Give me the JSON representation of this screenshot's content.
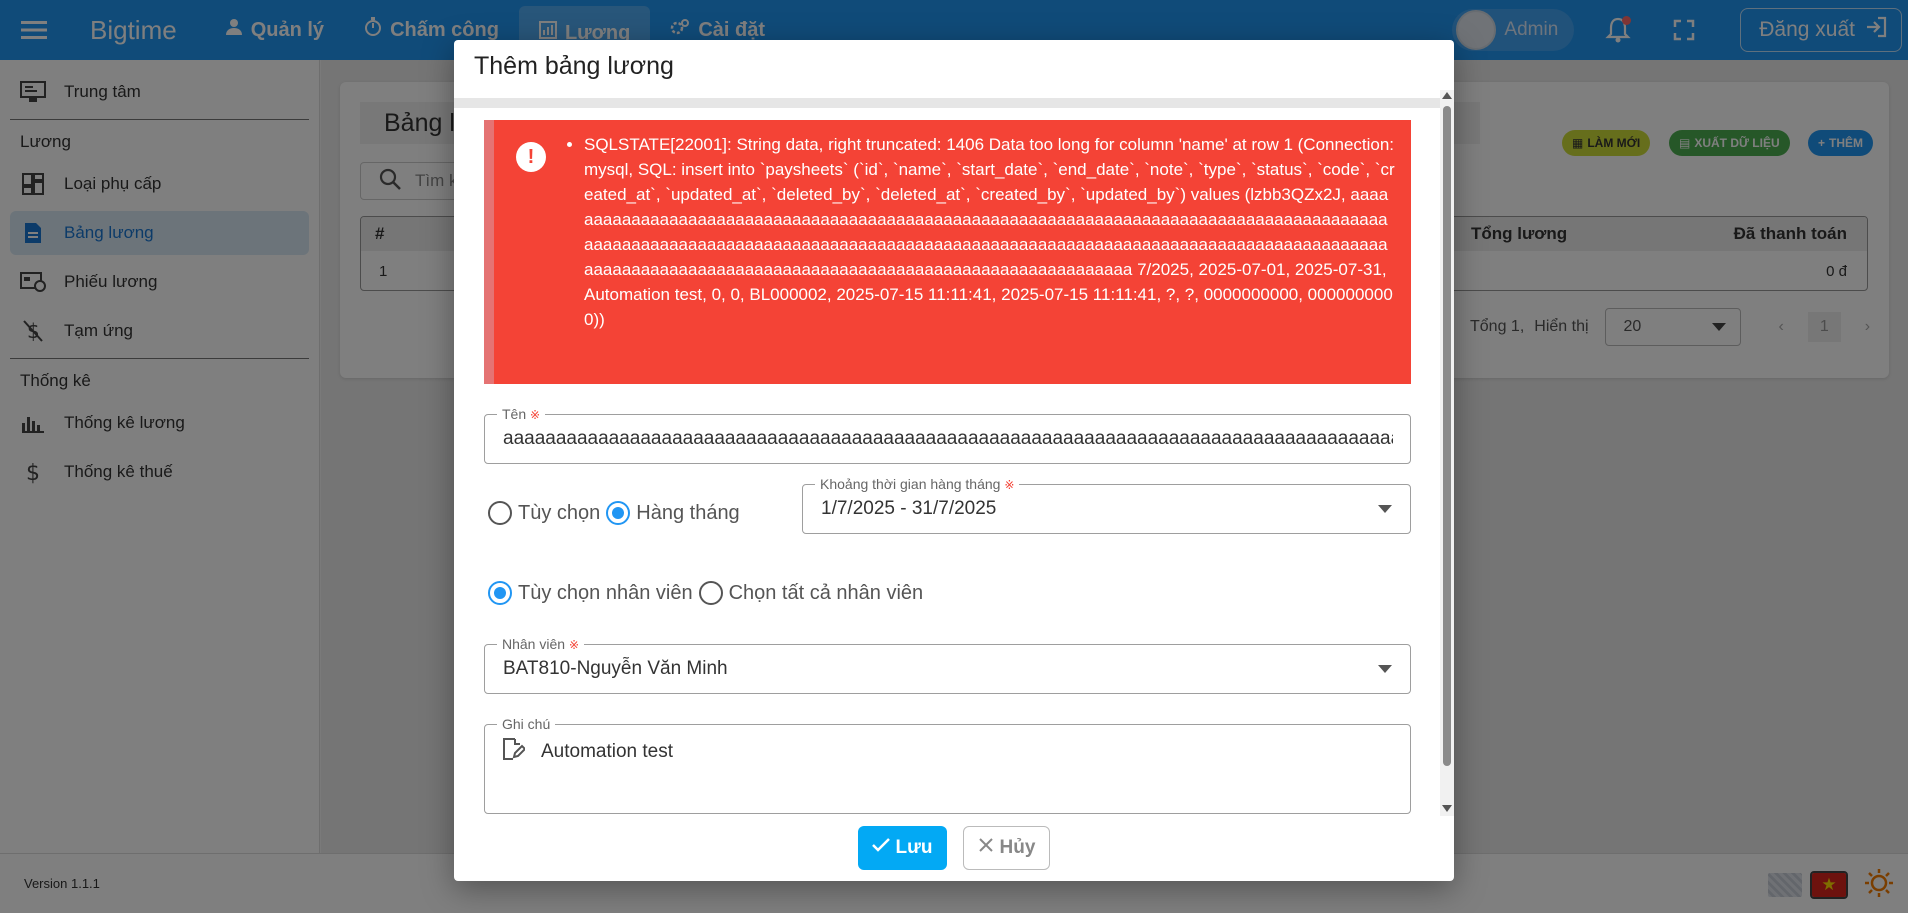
{
  "app": {
    "brand": "Bigtime",
    "nav": [
      {
        "label": "Quản lý"
      },
      {
        "label": "Chấm công"
      },
      {
        "label": "Lương"
      },
      {
        "label": "Cài đặt"
      }
    ],
    "user_name": "Admin",
    "logout_label": "Đăng xuất"
  },
  "sidebar": {
    "top_item": "Trung tâm",
    "section_luong": "Lương",
    "luong_items": [
      {
        "label": "Loại phụ cấp"
      },
      {
        "label": "Bảng lương"
      },
      {
        "label": "Phiếu lương"
      },
      {
        "label": "Tạm ứng"
      }
    ],
    "section_thongke": "Thống kê",
    "thongke_items": [
      {
        "label": "Thống kê lương"
      },
      {
        "label": "Thống kê thuế"
      }
    ]
  },
  "page": {
    "title": "Bảng l",
    "btn_refresh": "LÀM MỚI",
    "btn_export": "XUẤT DỮ LIỆU",
    "btn_add": "THÊM",
    "search_placeholder": "Tìm k",
    "table": {
      "col_index": "#",
      "col_total": "Tổng lương",
      "col_paid": "Đã thanh toán",
      "row": {
        "index": "1",
        "paid": "0 đ"
      }
    },
    "pager": {
      "total_text": "Tổng 1,",
      "show_label": "Hiển thị",
      "page_size": "20",
      "current_page": "1"
    }
  },
  "footer": {
    "version": "Version 1.1.1"
  },
  "modal": {
    "title": "Thêm bảng lương",
    "error_message": "SQLSTATE[22001]: String data, right truncated: 1406 Data too long for column 'name' at row 1 (Connection: mysql, SQL: insert into `paysheets` (`id`, `name`, `start_date`, `end_date`, `note`, `type`, `status`, `code`, `created_at`, `updated_at`, `deleted_by`, `deleted_at`, `created_by`, `updated_by`) values (lzbb3QZx2J, aaaaaaaaaaaaaaaaaaaaaaaaaaaaaaaaaaaaaaaaaaaaaaaaaaaaaaaaaaaaaaaaaaaaaaaaaaaaaaaaaaaaaaaaaaaaaaaaaaaaaaaaaaaaaaaaaaaaaaaaaaaaaaaaaaaaaaaaaaaaaaaaaaaaaaaaaaaaaaaaaaaaaaaaaaaaaaaaaaaaaaaaaaaaaaaaaaaaaaaaaaaaaaaaaaaaaaaaaaaaaaaaaaaaaaaa 7/2025, 2025-07-01, 2025-07-31, Automation test, 0, 0, BL000002, 2025-07-15 11:11:41, 2025-07-15 11:11:41, ?, ?, 0000000000, 0000000000))",
    "name_label": "Tên",
    "name_value": "aaaaaaaaaaaaaaaaaaaaaaaaaaaaaaaaaaaaaaaaaaaaaaaaaaaaaaaaaaaaaaaaaaaaaaaaaaaaaaaaaaaaaaaaaaaaaaaaaaaaaaaaaaaaaaaa",
    "req_mark": "※",
    "radio_custom": "Tùy chọn",
    "radio_monthly": "Hàng tháng",
    "period_label": "Khoảng thời gian hàng tháng",
    "period_value": "1/7/2025 - 31/7/2025",
    "radio_choose_employee": "Tùy chọn nhân viên",
    "radio_all_employees": "Chọn tất cả nhân viên",
    "employee_label": "Nhân viên",
    "employee_value": "BAT810-Nguyễn Văn Minh",
    "note_label": "Ghi chú",
    "note_value": "Automation test",
    "save_label": "Lưu",
    "cancel_label": "Hủy"
  },
  "colors": {
    "primary": "#2196f3",
    "error": "#f44336",
    "save": "#03a9f4"
  }
}
